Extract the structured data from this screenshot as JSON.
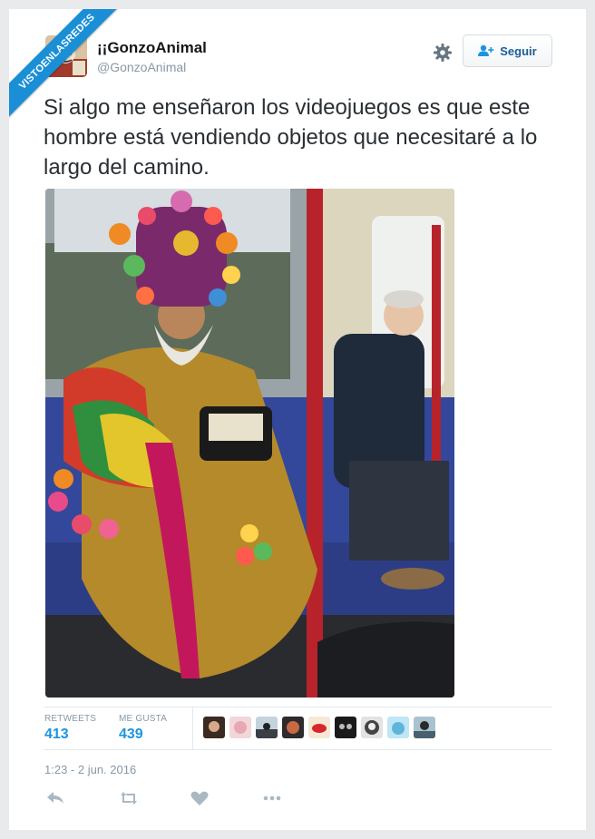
{
  "watermark": {
    "text": "VISTOENLASREDES"
  },
  "tweet": {
    "display_name": "¡¡GonzoAnimal",
    "handle": "@GonzoAnimal",
    "follow_label": "Seguir",
    "text": "Si algo me enseñaron los videojuegos es que este hombre está vendiendo objetos que necesitaré a lo largo del camino.",
    "photo_alt": "Hombre con traje colorido en el metro",
    "timestamp": "1:23 - 2 jun. 2016"
  },
  "stats": {
    "retweets_label": "RETWEETS",
    "retweets_value": "413",
    "likes_label": "ME GUSTA",
    "likes_value": "439"
  },
  "icons": {
    "settings": "gear-icon",
    "follow": "person-plus-icon",
    "reply": "reply-icon",
    "retweet": "retweet-icon",
    "like": "heart-icon",
    "more": "more-icon"
  },
  "colors": {
    "accent": "#1b95e0",
    "ribbon": "#1a8fd6",
    "text": "#292f33",
    "muted": "#8899a6"
  }
}
